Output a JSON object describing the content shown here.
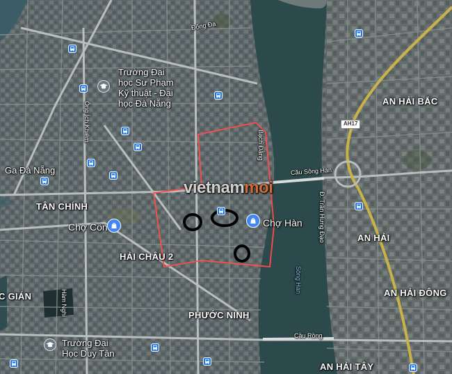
{
  "map": {
    "title": "",
    "colors": {
      "land": "#5b6466",
      "river": "#2c4a4b",
      "sea": "#3b5e66",
      "road_major": "#b7bcbc",
      "road_minor": "#8d9495",
      "highway": "#c9b24a",
      "boundary": "#ff4d4d",
      "marker": "#000000",
      "bus_stop": "#1a73e8",
      "place_pin": "#4285f4"
    },
    "area_labels": {
      "an_hai_bac": "AN HẢI BẮC",
      "an_hai": "AN HẢI",
      "an_hai_dong": "AN HẢI ĐÔNG",
      "an_hai_tay": "AN HẢI TÂY",
      "tan_chinh": "TÂN CHÍNH",
      "hai_chau_2": "HẢI CHÂU 2",
      "phuoc_ninh": "PHƯỚC NINH",
      "c_gian": "C GIÁN"
    },
    "poi_labels": {
      "cho_han": "Chợ Hàn",
      "cho_con": "Chợ Cồn",
      "ga_da_nang": "Ga Đà Nẵng",
      "su_pham_line1": "Trường Đại",
      "su_pham_line2": "học Sư Phạm",
      "su_pham_line3": "Kỹ thuật - Đại",
      "su_pham_line4": "học Đà Nẵng",
      "duy_tan_line1": "Trường Đại",
      "duy_tan_line2": "Học Duy Tân"
    },
    "street_labels": {
      "dong_da": "Đống Đa",
      "ong_ich_khiem": "Ông Ích Khiêm",
      "bach_dang": "Bạch Đằng",
      "cau_song_han": "Cầu Sông Hàn",
      "tran_hung_dao": "Đ. Trần Hưng Đạo",
      "song_han": "Sông Hàn",
      "cau_rong": "Cầu Rồng",
      "ham_nghi": "Hàm Nghi"
    },
    "route_shield": "AH17",
    "watermark": {
      "part1": "vietnam",
      "part2": "moi"
    },
    "icons": {
      "bus": "bus-stop-icon",
      "shopping": "shopping-bag-icon",
      "school": "graduation-cap-icon"
    }
  }
}
